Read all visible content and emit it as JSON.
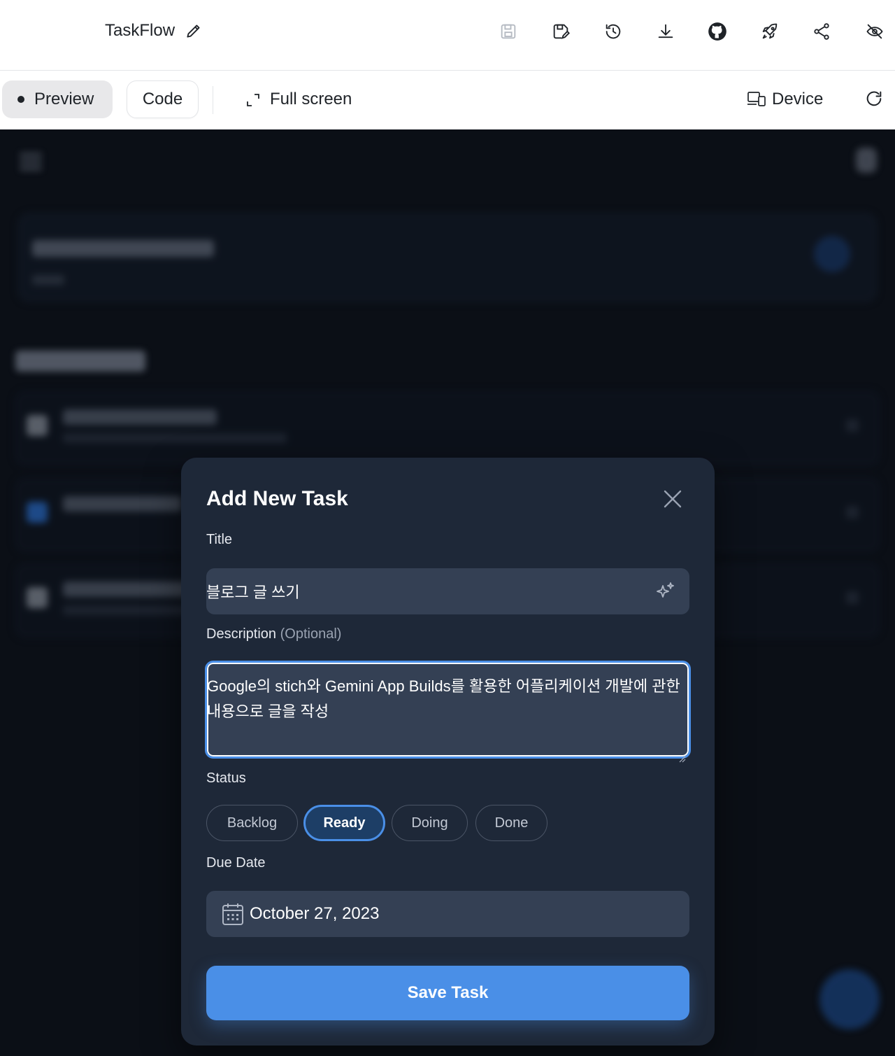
{
  "app": {
    "title": "TaskFlow"
  },
  "header_icons": [
    "save-icon",
    "save-as-icon",
    "history-icon",
    "download-icon",
    "github-icon",
    "deploy-rocket-icon",
    "share-icon",
    "hide-icon"
  ],
  "toolbar": {
    "preview_label": "Preview",
    "code_label": "Code",
    "fullscreen_label": "Full screen",
    "device_label": "Device"
  },
  "modal": {
    "title": "Add New Task",
    "title_label": "Title",
    "title_value": "블로그 글 쓰기",
    "description_label": "Description",
    "description_optional": "(Optional)",
    "description_value": "Google의 stich와 Gemini App Builds를 활용한 어플리케이션 개발에 관한 내용으로 글을 작성",
    "status_label": "Status",
    "status_options": [
      "Backlog",
      "Ready",
      "Doing",
      "Done"
    ],
    "status_selected": "Ready",
    "due_date_label": "Due Date",
    "due_date_value": "October 27, 2023",
    "save_label": "Save Task"
  },
  "colors": {
    "accent": "#4a8fe7",
    "modal_bg": "#1e2838",
    "field_bg": "#344054",
    "preview_bg": "#0b0f16"
  }
}
